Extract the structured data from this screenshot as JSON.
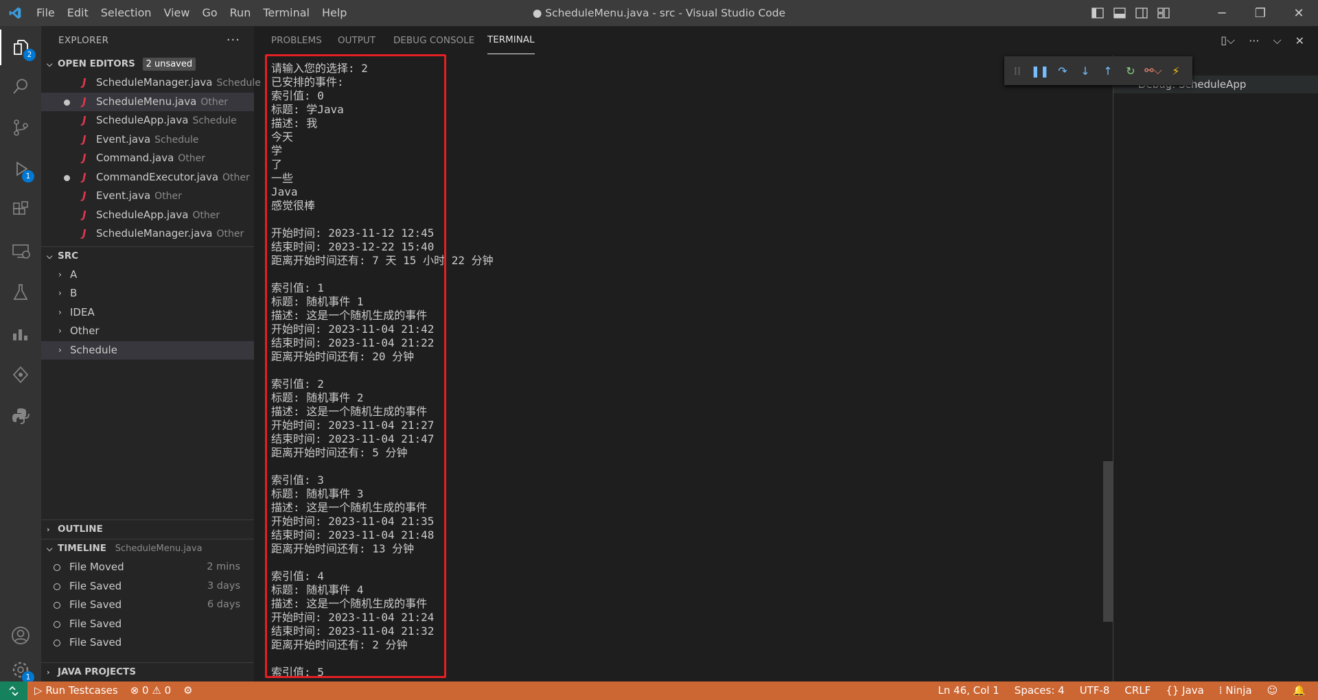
{
  "window": {
    "title": "● ScheduleMenu.java - src - Visual Studio Code"
  },
  "menu": [
    "File",
    "Edit",
    "Selection",
    "View",
    "Go",
    "Run",
    "Terminal",
    "Help"
  ],
  "activity": {
    "explorer_badge": "2",
    "debug_badge": "1",
    "settings_badge": "1"
  },
  "explorer": {
    "title": "EXPLORER",
    "open_editors": {
      "label": "OPEN EDITORS",
      "badge": "2 unsaved",
      "items": [
        {
          "name": "ScheduleManager.java",
          "desc": "Schedule"
        },
        {
          "name": "ScheduleMenu.java",
          "desc": "Other"
        },
        {
          "name": "ScheduleApp.java",
          "desc": "Schedule"
        },
        {
          "name": "Event.java",
          "desc": "Schedule"
        },
        {
          "name": "Command.java",
          "desc": "Other"
        },
        {
          "name": "CommandExecutor.java",
          "desc": "Other"
        },
        {
          "name": "Event.java",
          "desc": "Other"
        },
        {
          "name": "ScheduleApp.java",
          "desc": "Other"
        },
        {
          "name": "ScheduleManager.java",
          "desc": "Other"
        }
      ]
    },
    "src": {
      "label": "SRC",
      "folders": [
        "A",
        "B",
        "IDEA",
        "Other",
        "Schedule"
      ]
    },
    "outline": {
      "label": "OUTLINE"
    },
    "timeline": {
      "label": "TIMELINE",
      "file": "ScheduleMenu.java",
      "items": [
        {
          "label": "File Moved",
          "time": "2 mins"
        },
        {
          "label": "File Saved",
          "time": "3 days"
        },
        {
          "label": "File Saved",
          "time": "6 days"
        },
        {
          "label": "File Saved",
          "time": ""
        },
        {
          "label": "File Saved",
          "time": ""
        }
      ]
    },
    "java_projects": {
      "label": "JAVA PROJECTS"
    }
  },
  "panel": {
    "tabs": [
      "PROBLEMS",
      "OUTPUT",
      "DEBUG CONSOLE",
      "TERMINAL"
    ],
    "active_tab": "TERMINAL"
  },
  "terminal": {
    "lines": [
      "请输入您的选择: 2",
      "已安排的事件:",
      "索引值: 0",
      "标题: 学Java",
      "描述: 我",
      "今天",
      "学",
      "了",
      "一些",
      "Java",
      "感觉很棒",
      "",
      "开始时间: 2023-11-12 12:45",
      "结束时间: 2023-12-22 15:40",
      "距离开始时间还有: 7 天 15 小时 22 分钟",
      "",
      "索引值: 1",
      "标题: 随机事件 1",
      "描述: 这是一个随机生成的事件",
      "开始时间: 2023-11-04 21:42",
      "结束时间: 2023-11-04 21:22",
      "距离开始时间还有: 20 分钟",
      "",
      "索引值: 2",
      "标题: 随机事件 2",
      "描述: 这是一个随机生成的事件",
      "开始时间: 2023-11-04 21:27",
      "结束时间: 2023-11-04 21:47",
      "距离开始时间还有: 5 分钟",
      "",
      "索引值: 3",
      "标题: 随机事件 3",
      "描述: 这是一个随机生成的事件",
      "开始时间: 2023-11-04 21:35",
      "结束时间: 2023-11-04 21:48",
      "距离开始时间还有: 13 分钟",
      "",
      "索引值: 4",
      "标题: 随机事件 4",
      "描述: 这是一个随机生成的事件",
      "开始时间: 2023-11-04 21:24",
      "结束时间: 2023-11-04 21:32",
      "距离开始时间还有: 2 分钟",
      "",
      "索引值: 5"
    ]
  },
  "debug_session": {
    "label": "Debug: ScheduleApp"
  },
  "statusbar": {
    "run_testcases": "Run Testcases",
    "errors": "0",
    "warnings": "0",
    "position": "Ln 46, Col 1",
    "spaces": "Spaces: 4",
    "encoding": "UTF-8",
    "eol": "CRLF",
    "language": "Java",
    "ninja": "Ninja"
  },
  "colors": {
    "accent": "#0078d4",
    "statusbar": "#cc6633",
    "highlight_box": "#e51f23"
  }
}
